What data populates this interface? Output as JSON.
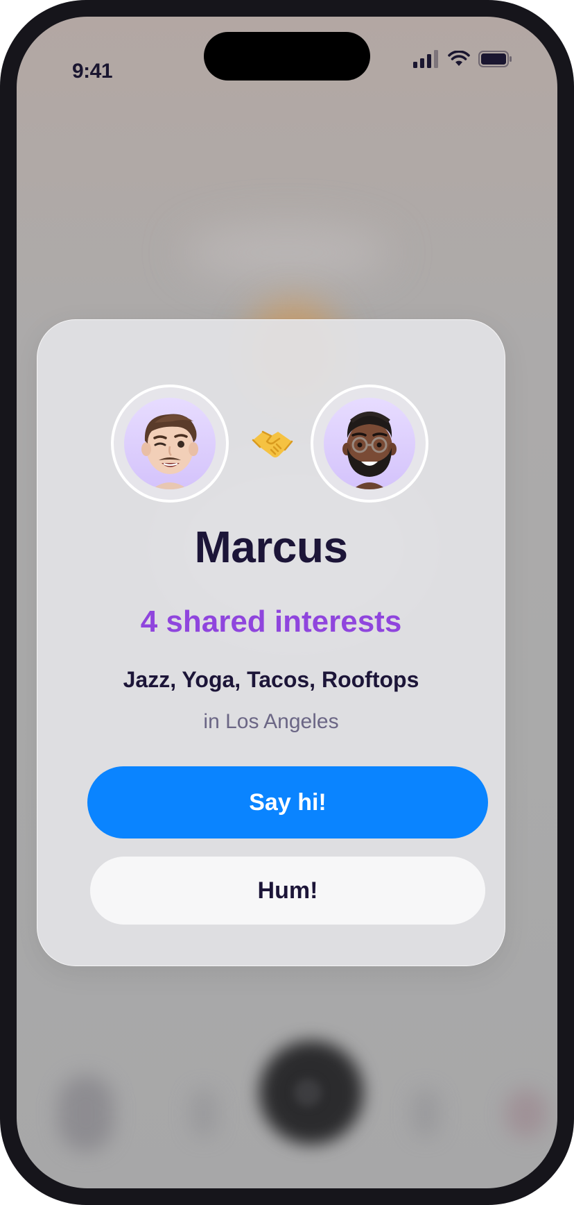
{
  "status_bar": {
    "time": "9:41"
  },
  "match_card": {
    "name": "Marcus",
    "shared_interests": "4 shared interests",
    "interests": "Jazz, Yoga, Tacos, Rooftops",
    "location": "in Los Angeles",
    "left_avatar_icon": "winking-man-memoji-icon",
    "right_avatar_icon": "bearded-man-glasses-memoji-icon",
    "connector_icon": "handshake-icon"
  },
  "actions": {
    "primary_label": "Say hi!",
    "secondary_label": "Hum!"
  },
  "colors": {
    "accent_purple": "#8f45dd",
    "primary_button": "#0a84ff",
    "title_text": "#1c1538",
    "secondary_text": "#6b6685"
  }
}
